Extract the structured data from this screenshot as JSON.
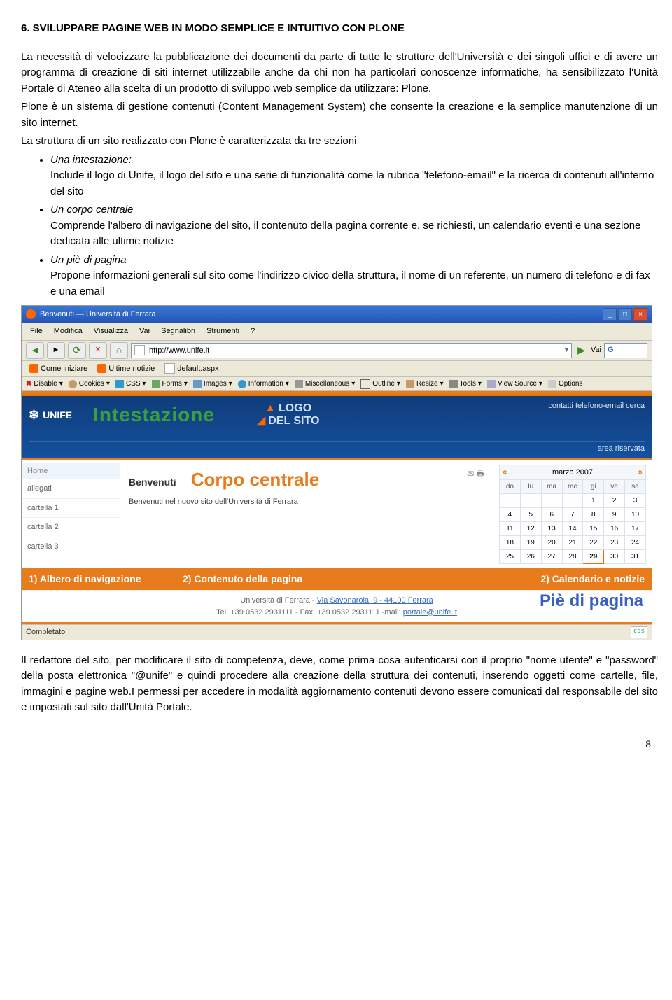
{
  "heading": "6. SVILUPPARE PAGINE WEB IN MODO SEMPLICE E INTUITIVO CON PLONE",
  "para1": "La necessità di velocizzare la pubblicazione dei documenti da parte di tutte le strutture dell'Università e dei singoli uffici e di avere un programma di creazione di siti internet utilizzabile anche da chi non ha particolari conoscenze informatiche, ha sensibilizzato l'Unità Portale di Ateneo alla scelta di un prodotto di sviluppo web semplice da utilizzare: Plone.",
  "para2": "Plone è un sistema di gestione contenuti (Content Management System) che consente la creazione e la semplice manutenzione di un sito internet.",
  "para3": "La struttura di un sito realizzato con Plone è caratterizzata da tre sezioni",
  "bullets": {
    "b1": {
      "title": "Una intestazione:",
      "l1": "Include il logo di Unife, il logo del sito e una serie di funzionalità come la rubrica \"telefono-email\" e la ricerca di contenuti all'interno del sito"
    },
    "b2": {
      "title": "Un corpo centrale",
      "l1": "Comprende l'albero di navigazione del sito, il contenuto della pagina corrente e, se richiesti, un calendario eventi e una sezione dedicata alle ultime notizie"
    },
    "b3": {
      "title": "Un piè di pagina",
      "l1": "Propone informazioni generali sul sito come l'indirizzo civico della struttura, il nome di un referente, un numero di telefono e di fax e una email"
    }
  },
  "browser": {
    "title": "Benvenuti — Università di Ferrara",
    "menus": [
      "File",
      "Modifica",
      "Visualizza",
      "Vai",
      "Segnalibri",
      "Strumenti",
      "?"
    ],
    "url": "http://www.unife.it",
    "vai": "Vai",
    "bookmarks": {
      "b1": "Come iniziare",
      "b2": "Ultime notizie",
      "b3": "default.aspx"
    },
    "dev": [
      "Disable",
      "Cookies",
      "CSS",
      "Forms",
      "Images",
      "Information",
      "Miscellaneous",
      "Outline",
      "Resize",
      "Tools",
      "View Source",
      "Options"
    ],
    "status": "Completato",
    "css": "css"
  },
  "site": {
    "unife": "UNIFE",
    "intest": "Intestazione",
    "logo1": "LOGO",
    "logo2": "DEL SITO",
    "toplinks": "contatti   telefono-email   cerca",
    "area": "area riservata",
    "nav": {
      "home": "Home",
      "n1": "allegati",
      "n2": "cartella 1",
      "n3": "cartella 2",
      "n4": "cartella 3"
    },
    "main": {
      "benv": "Benvenuti",
      "corpo": "Corpo centrale",
      "sub": "Benvenuti nel nuovo sito dell'Università di Ferrara"
    },
    "cal": {
      "month": "marzo 2007",
      "days": [
        "do",
        "lu",
        "ma",
        "me",
        "gi",
        "ve",
        "sa"
      ],
      "weeks": [
        [
          "",
          "",
          "",
          "",
          "1",
          "2",
          "3"
        ],
        [
          "4",
          "5",
          "6",
          "7",
          "8",
          "9",
          "10"
        ],
        [
          "11",
          "12",
          "13",
          "14",
          "15",
          "16",
          "17"
        ],
        [
          "18",
          "19",
          "20",
          "21",
          "22",
          "23",
          "24"
        ],
        [
          "25",
          "26",
          "27",
          "28",
          "29",
          "30",
          "31"
        ]
      ],
      "today": "29"
    },
    "annot": {
      "a1": "1) Albero di navigazione",
      "a2": "2) Contenuto della pagina",
      "a3": "2) Calendario e notizie"
    },
    "footer": {
      "l1a": "Università di Ferrara - ",
      "l1b": "Via Savonarola, 9 - 44100 Ferrara",
      "l2a": "Tel. +39 0532 2931111 - Fax. +39 0532 2931111 -mail: ",
      "l2b": "portale@unife.it",
      "pie": "Piè di pagina"
    }
  },
  "para4": "Il redattore del sito, per modificare il sito di competenza, deve, come prima cosa autenticarsi con il proprio \"nome utente\" e \"password\" della posta elettronica \"@unife\" e quindi procedere alla creazione della struttura dei contenuti, inserendo oggetti come cartelle, file, immagini e pagine web.I permessi per accedere in modalità aggiornamento contenuti devono essere comunicati dal responsabile del sito e impostati sul sito dall'Unità Portale.",
  "pagenum": "8"
}
